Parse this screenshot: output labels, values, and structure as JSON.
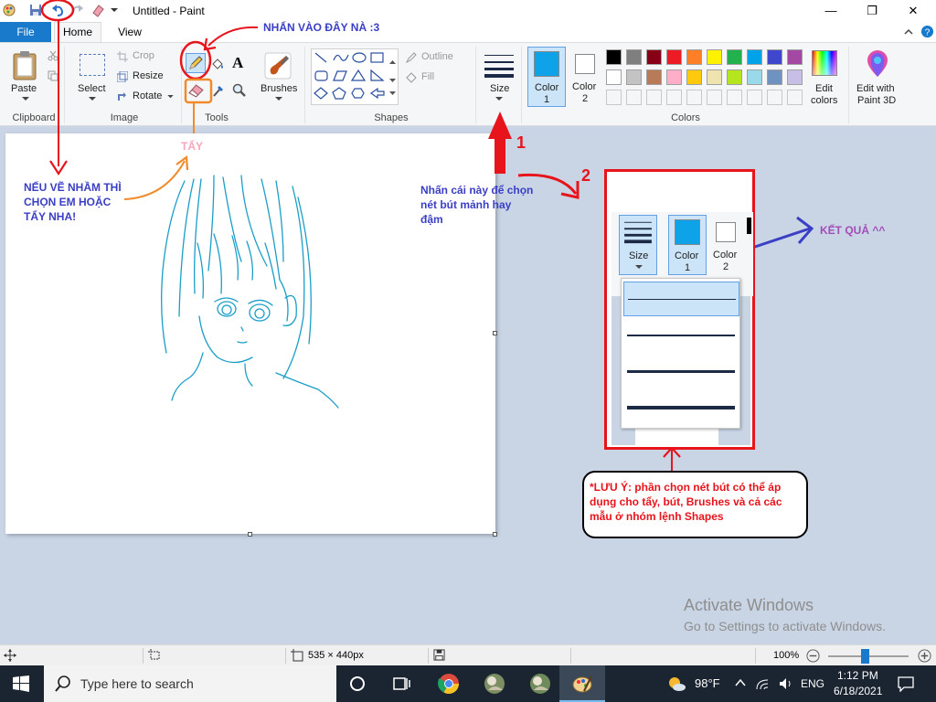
{
  "window": {
    "title": "Untitled - Paint",
    "minimize_glyph": "—",
    "maximize_glyph": "❐",
    "close_glyph": "✕",
    "quick_access_icons": [
      "paint-app-icon",
      "save-icon",
      "undo-icon",
      "redo-icon",
      "eraser-icon",
      "customize-dropdown-icon"
    ]
  },
  "menu": {
    "file": "File",
    "home": "Home",
    "view": "View"
  },
  "ribbon": {
    "clipboard": {
      "paste": "Paste",
      "group": "Clipboard"
    },
    "image": {
      "select": "Select",
      "crop": "Crop",
      "resize": "Resize",
      "rotate": "Rotate",
      "group": "Image"
    },
    "tools": {
      "group": "Tools",
      "text_glyph": "A"
    },
    "brushes": {
      "label": "Brushes"
    },
    "shapes": {
      "outline": "Outline",
      "fill": "Fill",
      "group": "Shapes"
    },
    "size": {
      "label": "Size"
    },
    "colors": {
      "color1_label": "Color",
      "color1_num": "1",
      "color2_label": "Color",
      "color2_num": "2",
      "edit_colors_1": "Edit",
      "edit_colors_2": "colors",
      "group": "Colors",
      "color1": "#0ea2e8",
      "color2": "#ffffff",
      "palette_row1": [
        "#000000",
        "#7f7f7f",
        "#880015",
        "#ed1c24",
        "#ff7f27",
        "#fff200",
        "#22b14c",
        "#00a2e8",
        "#3f48cc",
        "#a349a4"
      ],
      "palette_row2": [
        "#ffffff",
        "#c3c3c3",
        "#b97a57",
        "#ffaec9",
        "#ffc90e",
        "#efe4b0",
        "#b5e61d",
        "#99d9ea",
        "#7092be",
        "#c8bfe7"
      ]
    },
    "paint3d": {
      "line1": "Edit with",
      "line2": "Paint 3D"
    }
  },
  "status": {
    "dimensions": "535 × 440px",
    "zoom": "100%",
    "zoom_level": 1.0
  },
  "taskbar": {
    "search_placeholder": "Type here to search",
    "weather": "98°F",
    "language": "ENG",
    "time": "1:12 PM",
    "date": "6/18/2021"
  },
  "watermark": {
    "line1": "Activate Windows",
    "line2": "Go to Settings to activate Windows."
  },
  "annotations": {
    "click_here": "NHẤN VÀO ĐÂY NÀ :3",
    "mistake_1": "NẾU VẼ NHẦM THÌ",
    "mistake_2": "CHỌN EM HOẶC",
    "mistake_3": "TẨY NHA!",
    "eraser_label": "TẨY",
    "size_hint_1": "Nhấn cái này để chọn",
    "size_hint_2": "nét bút mảnh hay",
    "size_hint_3": "đậm",
    "num1": "1",
    "num2": "2",
    "result": "KẾT QUẢ ^^",
    "note_1": "*LƯU Ý: phần chọn nét bút có thể áp",
    "note_2": "dụng cho tẩy, bút, Brushes và cả các",
    "note_3": "mẫu ở nhóm lệnh Shapes",
    "inset_size": "Size",
    "inset_color1": "Color",
    "inset_color1_num": "1",
    "inset_color2": "Color",
    "inset_color2_num": "2"
  },
  "accent": {
    "red": "#e8141c",
    "blue": "#3a3fc5",
    "orange": "#f08a2a",
    "purple": "#a24db8"
  }
}
